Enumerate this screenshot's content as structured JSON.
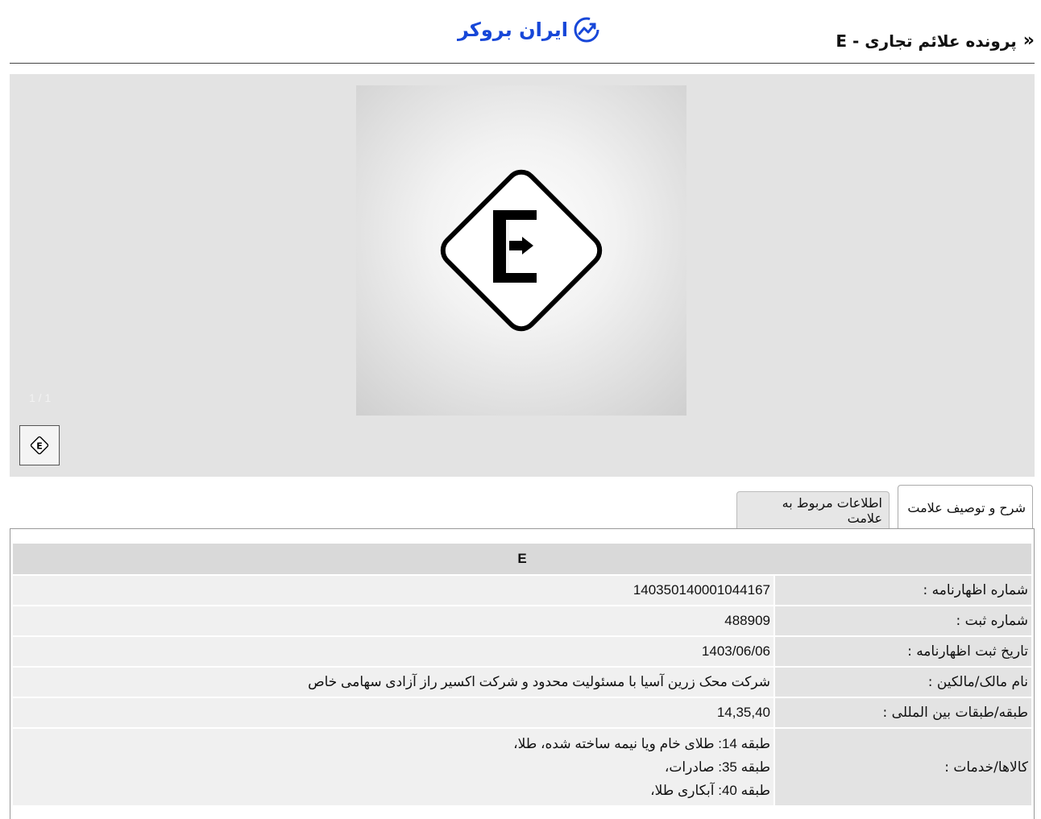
{
  "header": {
    "logo_text": "ایران بروکر",
    "page_title": "پرونده علائم تجاری - E"
  },
  "gallery": {
    "counter": "1 / 1",
    "mark_letter": "E"
  },
  "tabs": [
    {
      "label": "شرح و توصیف علامت",
      "active": true
    },
    {
      "label": "اطلاعات مربوط به علامت",
      "active": false
    }
  ],
  "info": {
    "heading": "E",
    "rows": [
      {
        "label": "شماره اظهارنامه :",
        "value": "140350140001044167"
      },
      {
        "label": "شماره ثبت :",
        "value": "488909"
      },
      {
        "label": "تاریخ ثبت اظهارنامه :",
        "value": "1403/06/06"
      },
      {
        "label": "نام مالک/مالکین :",
        "value": "شرکت محک زرین آسیا با مسئولیت محدود و شرکت اکسیر راز آزادی سهامی خاص"
      },
      {
        "label": "طبقه/طبقات بین المللی :",
        "value": "14,35,40"
      }
    ],
    "goods": {
      "label": "کالاها/خدمات :",
      "lines": [
        "طبقه 14: طلای خام ویا نیمه ساخته شده، طلا،",
        "طبقه 35: صادرات،",
        "طبقه 40: آبکاری طلا،"
      ]
    }
  },
  "colors": {
    "brand": "#1747d8",
    "gallery_bg": "#e3e3e3"
  }
}
